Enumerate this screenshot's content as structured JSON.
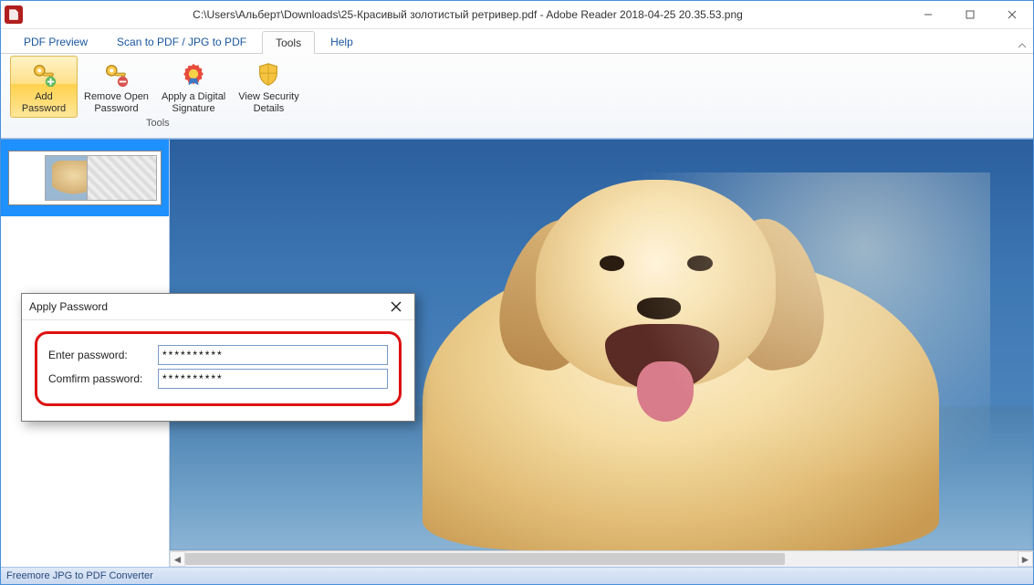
{
  "titlebar": {
    "title": "C:\\Users\\Альберт\\Downloads\\25-Красивый золотистый ретривер.pdf - Adobe Reader 2018-04-25 20.35.53.png"
  },
  "menu": {
    "tabs": [
      {
        "label": "PDF Preview"
      },
      {
        "label": "Scan to PDF / JPG to PDF"
      },
      {
        "label": "Tools"
      },
      {
        "label": "Help"
      }
    ],
    "active_index": 2
  },
  "ribbon": {
    "group_label": "Tools",
    "buttons": [
      {
        "label_line1": "Add",
        "label_line2": "Password",
        "selected": true,
        "icon": "key-add"
      },
      {
        "label_line1": "Remove Open",
        "label_line2": "Password",
        "selected": false,
        "icon": "key-remove"
      },
      {
        "label_line1": "Apply a Digital",
        "label_line2": "Signature",
        "selected": false,
        "icon": "ribbon-seal"
      },
      {
        "label_line1": "View Security",
        "label_line2": "Details",
        "selected": false,
        "icon": "shield"
      }
    ]
  },
  "dialog": {
    "title": "Apply Password",
    "enter_label": "Enter password:",
    "confirm_label": "Comfirm password:",
    "enter_value": "**********",
    "confirm_value": "**********"
  },
  "statusbar": {
    "text": "Freemore JPG to PDF Converter"
  }
}
